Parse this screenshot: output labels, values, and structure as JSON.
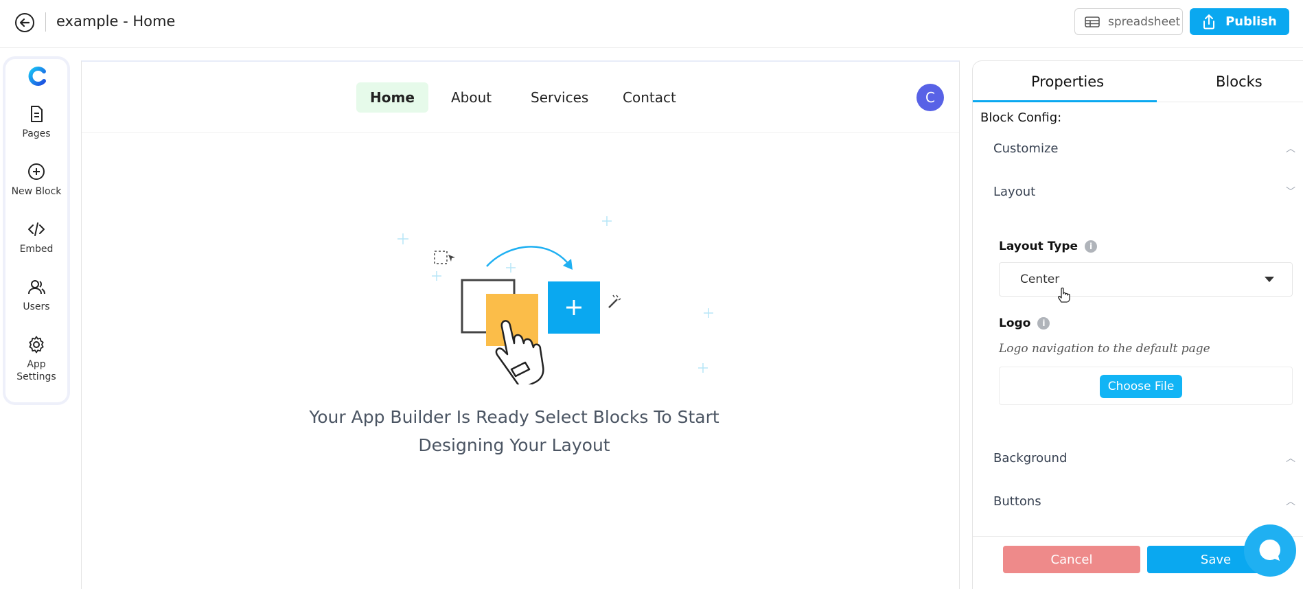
{
  "topbar": {
    "title": "example - Home",
    "spreadsheet_label": "spreadsheet",
    "publish_label": "Publish",
    "accent": "#0aa8f0"
  },
  "sidebar": {
    "items": [
      {
        "label": "Pages",
        "icon": "document-icon"
      },
      {
        "label": "New Block",
        "icon": "plus-circle-icon"
      },
      {
        "label": "Embed",
        "icon": "code-icon"
      },
      {
        "label": "Users",
        "icon": "users-icon"
      },
      {
        "label": "App Settings",
        "icon": "gear-icon"
      }
    ]
  },
  "canvas": {
    "nav": [
      "Home",
      "About",
      "Services",
      "Contact"
    ],
    "active_nav": "Home",
    "avatar_initial": "C",
    "message": "Your App Builder Is Ready Select Blocks To Start Designing Your Layout"
  },
  "panel": {
    "tabs": [
      "Properties",
      "Blocks"
    ],
    "active_tab": "Properties",
    "block_config_label": "Block Config:",
    "sections": {
      "customize": "Customize",
      "layout": "Layout",
      "background": "Background",
      "buttons": "Buttons"
    },
    "layout_type_label": "Layout Type",
    "layout_type_value": "Center",
    "logo_label": "Logo",
    "logo_hint": "Logo navigation to the default page",
    "choose_file_label": "Choose File",
    "cancel_label": "Cancel",
    "save_label": "Save"
  }
}
